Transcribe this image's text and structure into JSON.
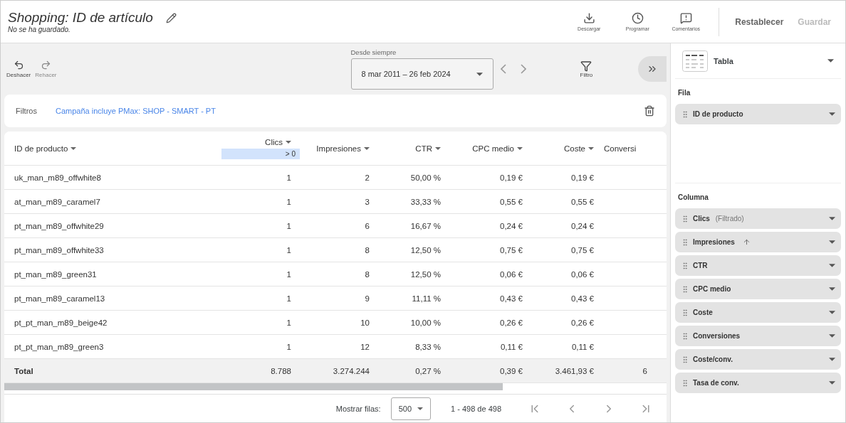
{
  "header": {
    "title": "Shopping: ID de artículo",
    "subtitle": "No se ha guardado.",
    "actions": [
      {
        "kind": "download",
        "label": "Descargar"
      },
      {
        "kind": "schedule",
        "label": "Programar"
      },
      {
        "kind": "feedback",
        "label": "Comentarios"
      }
    ],
    "reset": {
      "label": "Restablecer",
      "disabled": false
    },
    "save": {
      "label": "Guardar",
      "disabled": true
    }
  },
  "toolbar": {
    "history": [
      {
        "kind": "undo",
        "label": "Deshacer",
        "disabled": false
      },
      {
        "kind": "redo",
        "label": "Rehacer",
        "disabled": true
      }
    ],
    "date_range": {
      "label": "Desde siempre",
      "value": "8 mar 2011 – 26 feb 2024"
    },
    "filter_button": {
      "label": "Filtro"
    }
  },
  "filters": {
    "label": "Filtros",
    "value": "Campaña incluye PMax: SHOP - SMART - PT"
  },
  "table": {
    "columns": [
      {
        "label": "ID de producto"
      },
      {
        "label": "Clics",
        "filter": "> 0"
      },
      {
        "label": "Impresiones"
      },
      {
        "label": "CTR"
      },
      {
        "label": "CPC medio"
      },
      {
        "label": "Coste"
      },
      {
        "label": "Conversi"
      }
    ],
    "rows": [
      [
        "uk_man_m89_offwhite8",
        "1",
        "2",
        "50,00 %",
        "0,19 €",
        "0,19 €",
        ""
      ],
      [
        "at_man_m89_caramel7",
        "1",
        "3",
        "33,33 %",
        "0,55 €",
        "0,55 €",
        ""
      ],
      [
        "pt_man_m89_offwhite29",
        "1",
        "6",
        "16,67 %",
        "0,24 €",
        "0,24 €",
        ""
      ],
      [
        "pt_man_m89_offwhite33",
        "1",
        "8",
        "12,50 %",
        "0,75 €",
        "0,75 €",
        ""
      ],
      [
        "pt_man_m89_green31",
        "1",
        "8",
        "12,50 %",
        "0,06 €",
        "0,06 €",
        ""
      ],
      [
        "pt_man_m89_caramel13",
        "1",
        "9",
        "11,11 %",
        "0,43 €",
        "0,43 €",
        ""
      ],
      [
        "pt_pt_man_m89_beige42",
        "1",
        "10",
        "10,00 %",
        "0,26 €",
        "0,26 €",
        ""
      ],
      [
        "pt_pt_man_m89_green3",
        "1",
        "12",
        "8,33 %",
        "0,11 €",
        "0,11 €",
        ""
      ]
    ],
    "total": [
      "Total",
      "8.788",
      "3.274.244",
      "0,27 %",
      "0,39 €",
      "3.461,93 €",
      "6"
    ]
  },
  "pagination": {
    "rows_label": "Mostrar filas:",
    "rows_value": "500",
    "range": "1 - 498 de 498"
  },
  "sidebar": {
    "chart_type": "Tabla",
    "row_label": "Fila",
    "rows": [
      {
        "label": "ID de producto"
      }
    ],
    "column_label": "Columna",
    "columns": [
      {
        "label": "Clics",
        "note": "(Filtrado)",
        "sorted": false
      },
      {
        "label": "Impresiones",
        "sorted": true
      },
      {
        "label": "CTR",
        "sorted": false
      },
      {
        "label": "CPC medio",
        "sorted": false
      },
      {
        "label": "Coste",
        "sorted": false
      },
      {
        "label": "Conversiones",
        "sorted": false
      },
      {
        "label": "Coste/conv.",
        "sorted": false
      },
      {
        "label": "Tasa de conv.",
        "sorted": false
      }
    ]
  }
}
